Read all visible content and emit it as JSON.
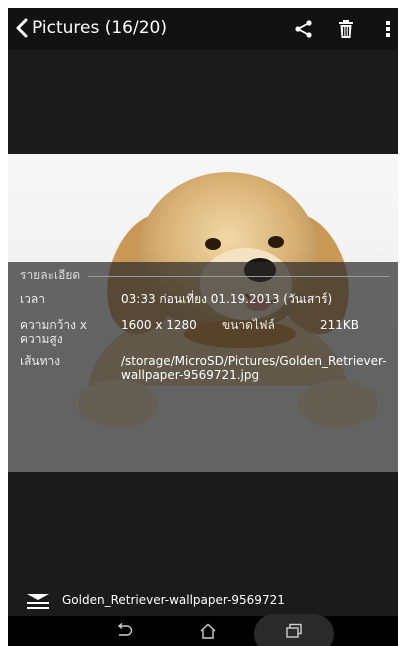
{
  "header": {
    "title": "Pictures (16/20)",
    "back_icon": "chevron-left-icon",
    "share_icon": "share-icon",
    "delete_icon": "trash-icon",
    "more_icon": "more-vertical-icon"
  },
  "details": {
    "heading": "รายละเอียด",
    "time_label": "เวลา",
    "time_value": "03:33 ก่อนเที่ยง 01.19.2013 (วันเสาร์)",
    "dimensions_label_1": "ความกว้าง x",
    "dimensions_label_2": "ความสูง",
    "dimensions_value": "1600 x 1280",
    "filesize_label": "ขนาดไฟล์",
    "filesize_value": "211KB",
    "path_label": "เส้นทาง",
    "path_value_1": "/storage/MicroSD/Pictures/Golden_Retriever-",
    "path_value_2": "wallpaper-9569721.jpg"
  },
  "footer": {
    "filename": "Golden_Retriever-wallpaper-9569721",
    "menu_icon": "menu-icon"
  },
  "navbar": {
    "back_icon": "nav-back-icon",
    "home_icon": "home-icon",
    "recents_icon": "recents-icon"
  },
  "colors": {
    "topbar": "#121212",
    "background": "#1b1b1b",
    "overlay": "#282828"
  }
}
